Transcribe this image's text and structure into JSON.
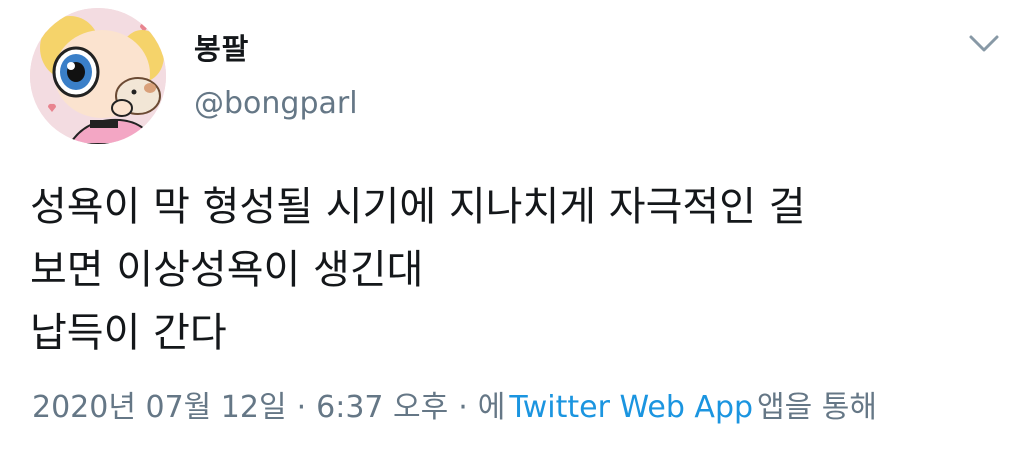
{
  "user": {
    "display_name": "봉팔",
    "handle": "@bongparl"
  },
  "tweet": {
    "lines": [
      "성욕이 막 형성될 시기에 지나치게 자극적인 걸",
      "보면 이상성욕이 생긴대",
      "납득이 간다"
    ]
  },
  "meta": {
    "date": "2020년 07월 12일",
    "separator": "·",
    "time": "6:37 오후",
    "via_prefix": "에",
    "app_name": "Twitter Web App",
    "via_suffix": "앱을 통해"
  },
  "icons": {
    "avatar": "avatar-image",
    "more": "chevron-down-icon"
  },
  "colors": {
    "text": "#14171a",
    "secondary": "#657786",
    "link": "#1b95e0"
  }
}
